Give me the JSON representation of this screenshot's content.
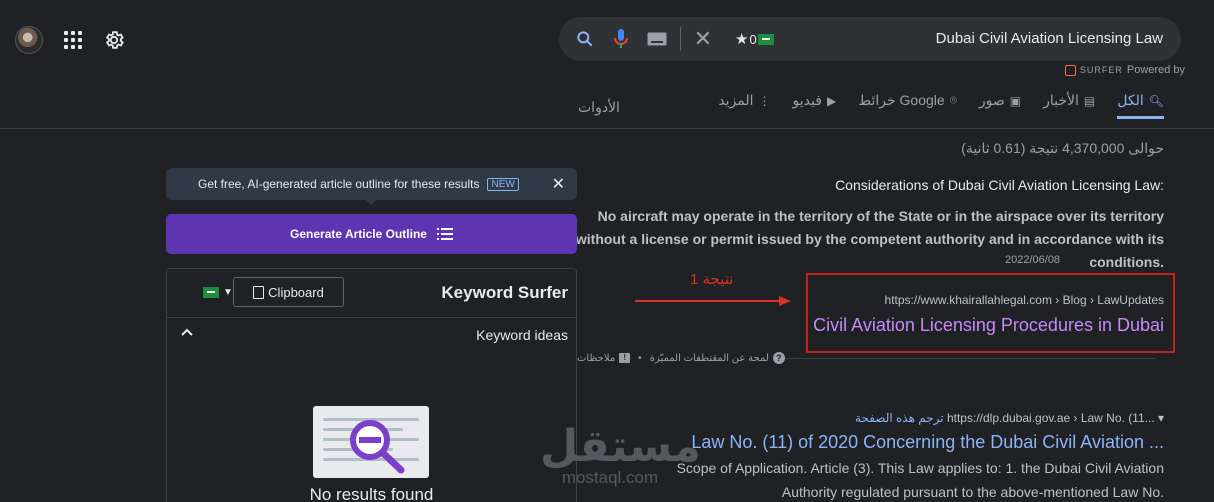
{
  "search": {
    "query": "Dubai Civil Aviation Licensing Law",
    "star_count": "0",
    "flag_text": "سعودي"
  },
  "surfer_brand": {
    "name": "SURFER",
    "powered": "Powered by"
  },
  "tabs": [
    {
      "label": "الكل",
      "icon": "search-icon",
      "active": true
    },
    {
      "label": "الأخبار",
      "icon": "news-icon"
    },
    {
      "label": "صور",
      "icon": "image-icon"
    },
    {
      "label": "خرائط Google",
      "icon": "map-pin-icon"
    },
    {
      "label": "فيديو",
      "icon": "video-icon"
    },
    {
      "label": "المزيد",
      "icon": "more-icon"
    }
  ],
  "tools_label": "الأدوات",
  "stats": "حوالى 4,370,000 نتيجة (0.61 ثانية)",
  "featured": {
    "heading": "Considerations of Dubai Civil Aviation Licensing Law:",
    "text": "No aircraft may operate in the territory of the State or in the airspace over its territory without a license or permit issued by the competent authority and in accordance with its conditions.",
    "date": "2022/06/08",
    "cite": "https://www.khairallahlegal.com › Blog › LawUpdates",
    "title": "Civil Aviation Licensing Procedures in Dubai",
    "about_label": "لمحة عن المقتطفات المميّزة",
    "feedback_label": "ملاحظات"
  },
  "annotation": {
    "label": "نتيجة 1"
  },
  "result2": {
    "cite": "https://dlp.dubai.gov.ae › Law No. (11... ▾",
    "translate": "ترجم هذه الصفحة",
    "title": "Law No. (11) of 2020 Concerning the Dubai Civil Aviation ...",
    "snippet1": "Scope of Application. Article (3). This Law applies to: 1. the Dubai Civil Aviation",
    "snippet2": "Authority regulated pursuant to the above-mentioned Law No."
  },
  "sidebar": {
    "promo_text": "Get free, AI-generated article outline for these results",
    "promo_badge": "NEW",
    "generate_label": "Generate Article Outline",
    "panel_title": "Keyword Surfer",
    "clipboard_label": "Clipboard",
    "keyword_ideas_label": "Keyword ideas",
    "no_results": "No results found"
  },
  "watermark": {
    "ar": "مستقل",
    "en": "mostaql.com"
  },
  "colors": {
    "background": "#202124",
    "link": "#8ab4f8",
    "visited": "#c58af9",
    "accent_purple": "#5e35b1",
    "annotation_red": "#c5221f"
  }
}
